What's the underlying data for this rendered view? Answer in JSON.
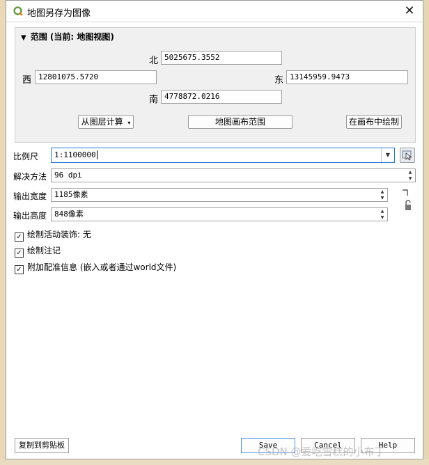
{
  "window": {
    "title": "地图另存为图像",
    "close_symbol": "✕"
  },
  "extent": {
    "header": "范围 (当前: 地图视图)",
    "north_label": "北",
    "north_value": "5025675.3552",
    "west_label": "西",
    "west_value": "12801075.5720",
    "east_label": "东",
    "east_value": "13145959.9473",
    "south_label": "南",
    "south_value": "4778872.0216",
    "calc_from_layer": "从图层计算",
    "map_canvas_extent": "地图画布范围",
    "draw_on_canvas": "在画布中绘制"
  },
  "settings": {
    "scale_label": "比例尺",
    "scale_value": "1:1100000",
    "resolution_label": "解决方法",
    "resolution_value": "96 dpi",
    "width_label": "输出宽度",
    "width_value": "1185像素",
    "height_label": "输出高度",
    "height_value": "848像素"
  },
  "options": [
    {
      "label": "绘制活动装饰: 无",
      "checked": true
    },
    {
      "label": "绘制注记",
      "checked": true
    },
    {
      "label": "附加配准信息 (嵌入或者通过world文件)",
      "checked": true
    }
  ],
  "footer": {
    "copy_clipboard": "复制到剪贴板",
    "save": "Save",
    "cancel": "Cancel",
    "help": "Help"
  },
  "watermark": "CSDN @爱吃雪糕的小布丁",
  "icons": {
    "app": "qgis-logo-icon",
    "dropdown": "chevron-down-icon",
    "map_pick": "cursor-pick-icon",
    "lock": "lock-open-icon"
  }
}
